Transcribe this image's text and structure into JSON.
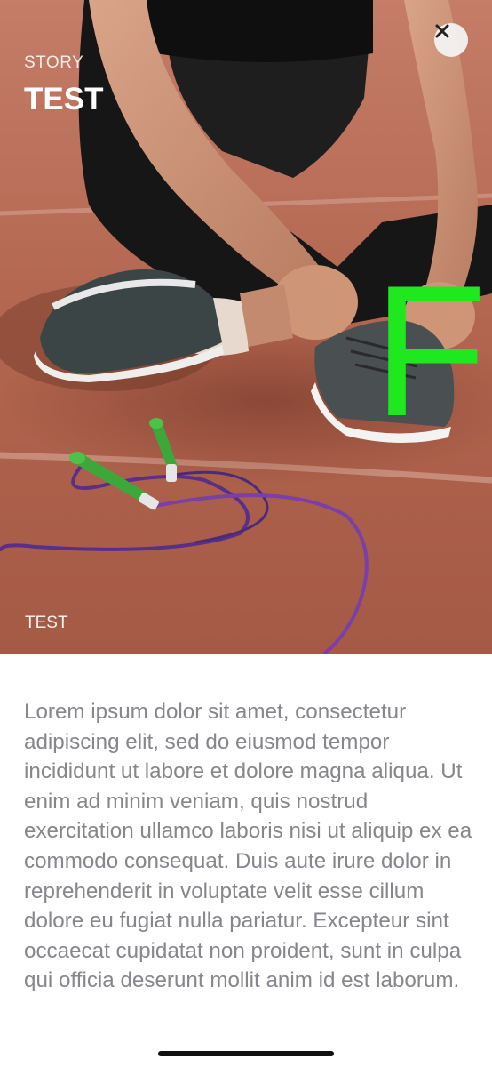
{
  "story": {
    "category": "STORY",
    "title": "TEST",
    "caption": "TEST",
    "overlay_text": "FI",
    "close_icon": "close-icon",
    "hero_image": "photo of person in sportswear tying sneakers on a red running track with jump rope"
  },
  "article": {
    "body": "Lorem ipsum dolor sit amet, consectetur adipiscing elit, sed do eiusmod tempor incididunt ut labore et dolore magna aliqua. Ut enim ad minim veniam, quis nostrud exercitation ullamco laboris nisi ut aliquip ex ea commodo consequat. Duis aute irure dolor in reprehenderit in voluptate velit esse cillum dolore eu fugiat nulla pariatur. Excepteur sint occaecat cupidatat non proident, sunt in culpa qui officia deserunt mollit anim id est laborum."
  },
  "colors": {
    "overlay_green": "#1fe81f",
    "body_text": "#86868c",
    "track": "#b36a55"
  }
}
